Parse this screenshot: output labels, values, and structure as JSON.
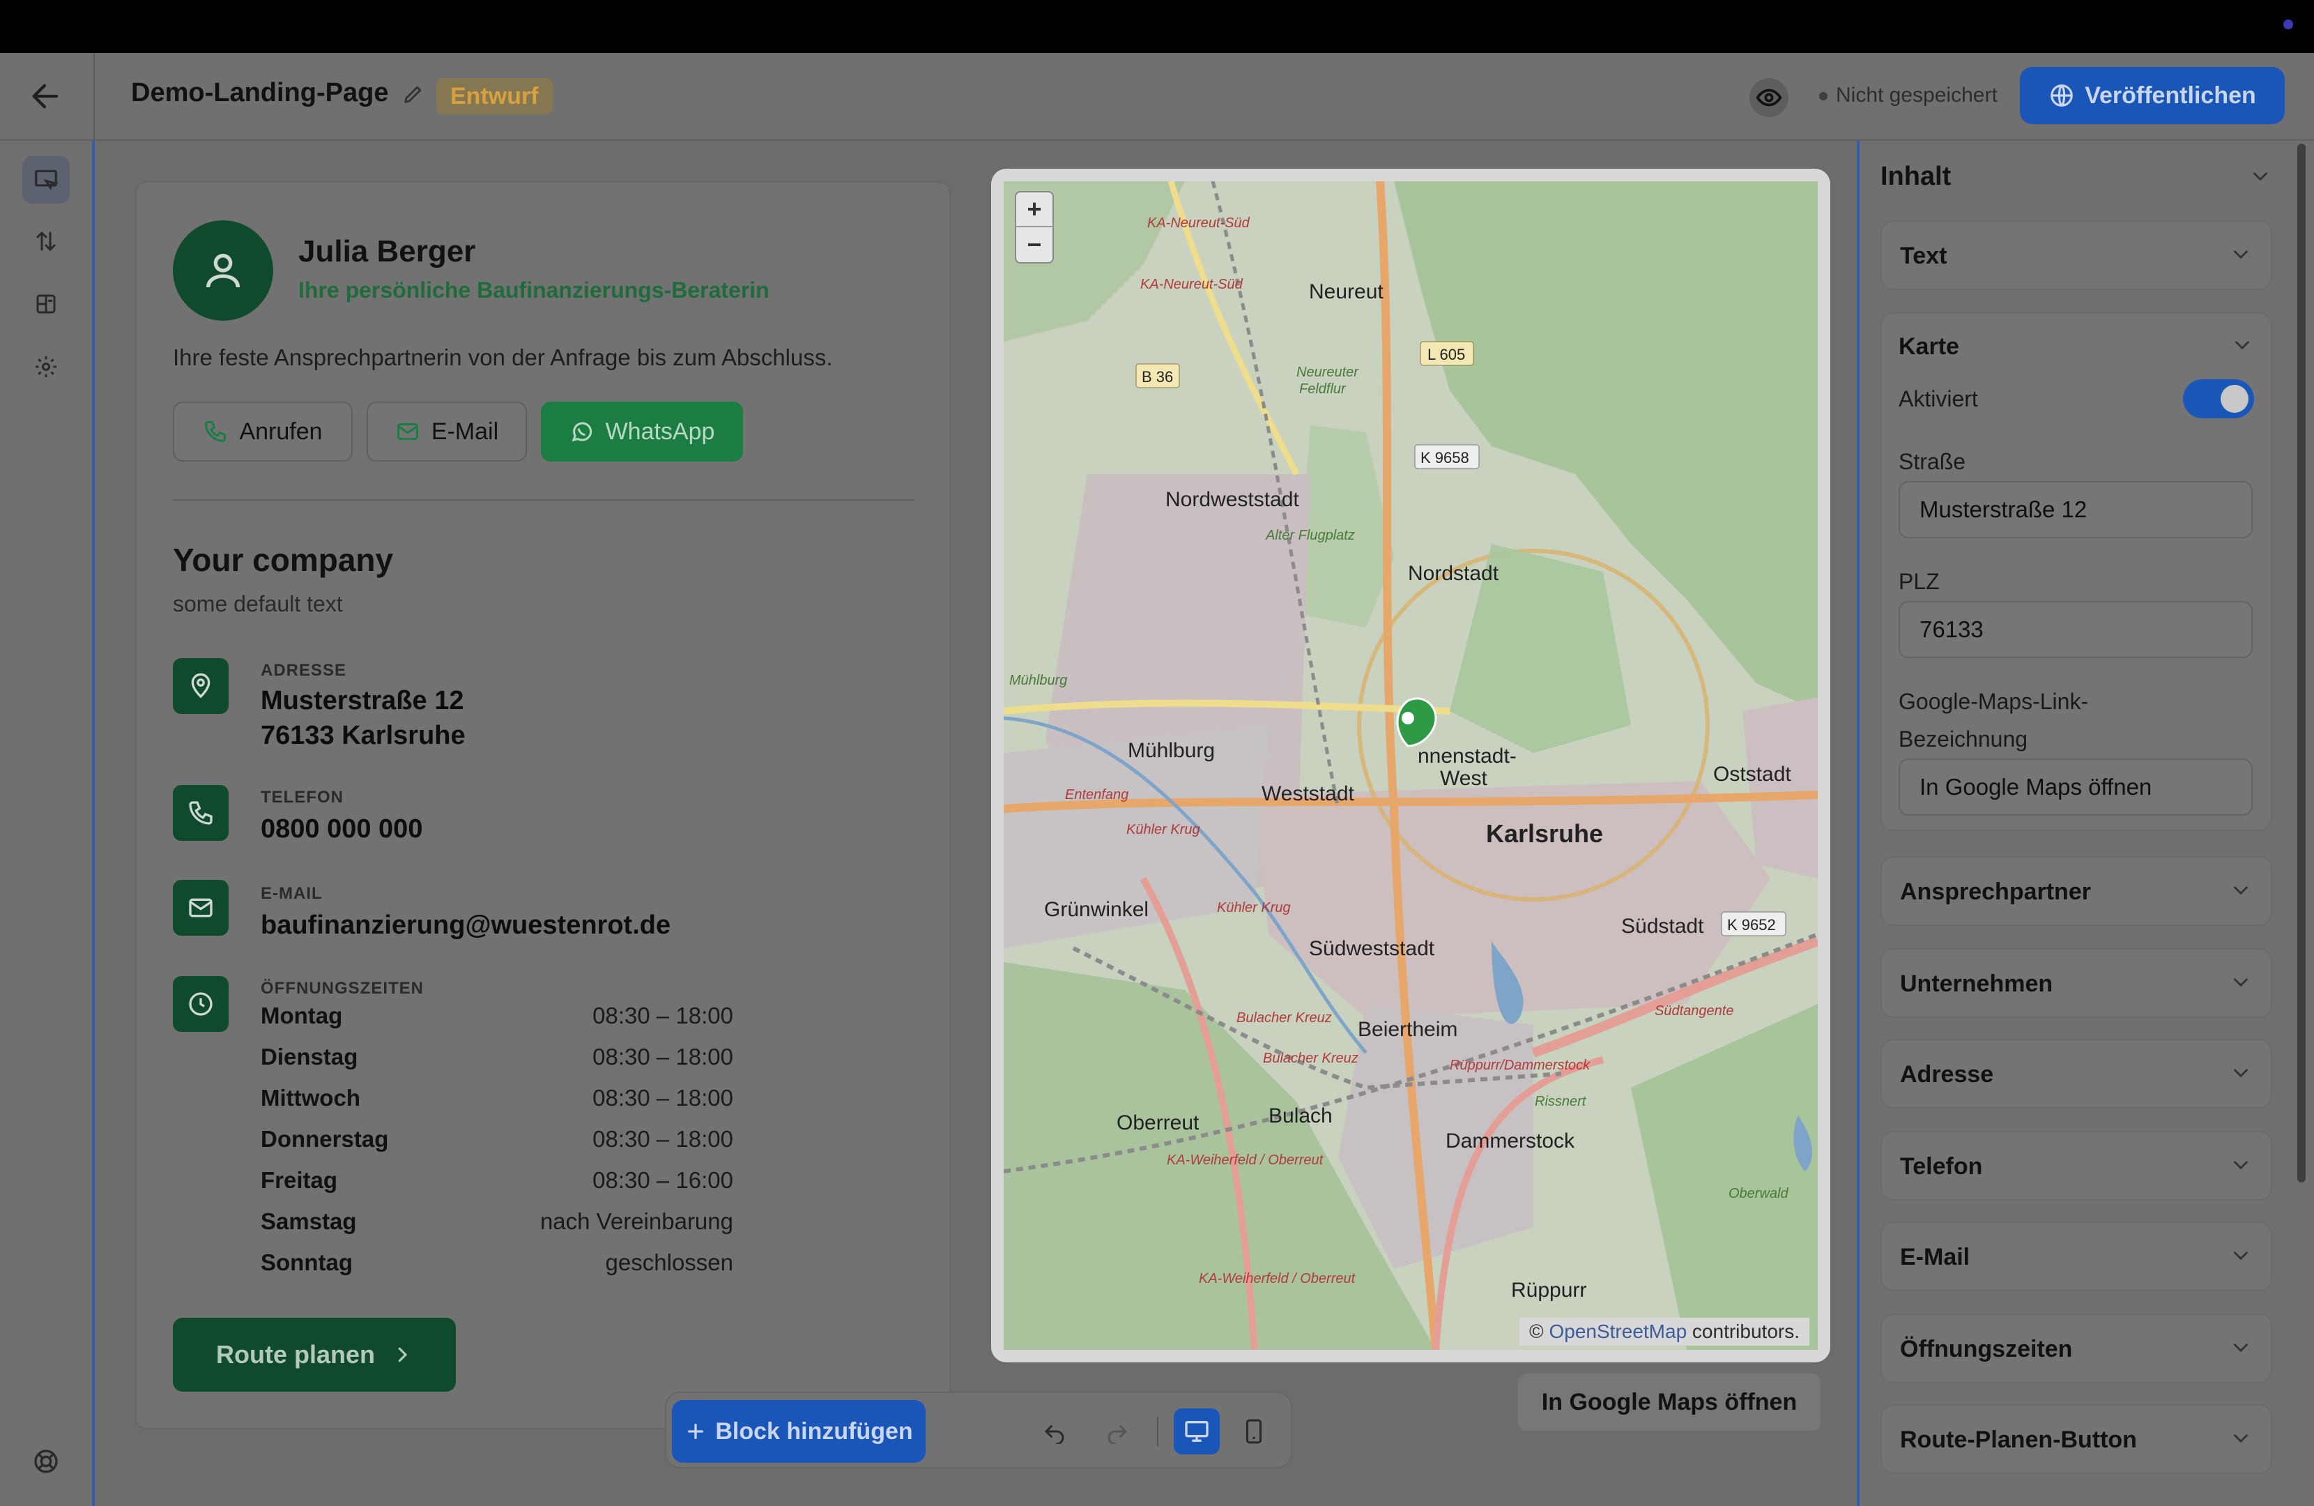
{
  "header": {
    "title": "Demo-Landing-Page",
    "status_badge": "Entwurf",
    "save_state": "Nicht gespeichert",
    "publish_label": "Veröffentlichen"
  },
  "contact_person": {
    "name": "Julia Berger",
    "role": "Ihre persönliche Baufinanzierungs-Beraterin",
    "description": "Ihre feste Ansprechpartnerin von der Anfrage bis zum Abschluss.",
    "buttons": {
      "call": "Anrufen",
      "email": "E-Mail",
      "whatsapp": "WhatsApp"
    }
  },
  "company": {
    "name": "Your company",
    "subtext": "some default text",
    "address_label": "ADRESSE",
    "address_line1": "Musterstraße 12",
    "address_line2": "76133 Karlsruhe",
    "phone_label": "TELEFON",
    "phone": "0800 000 000",
    "email_label": "E-MAIL",
    "email": "baufinanzierung@wuestenrot.de",
    "hours_label": "ÖFFNUNGSZEITEN",
    "hours": [
      {
        "day": "Montag",
        "time": "08:30 – 18:00"
      },
      {
        "day": "Dienstag",
        "time": "08:30 – 18:00"
      },
      {
        "day": "Mittwoch",
        "time": "08:30 – 18:00"
      },
      {
        "day": "Donnerstag",
        "time": "08:30 – 18:00"
      },
      {
        "day": "Freitag",
        "time": "08:30 – 16:00"
      },
      {
        "day": "Samstag",
        "time": "nach Vereinbarung"
      },
      {
        "day": "Sonntag",
        "time": "geschlossen"
      }
    ],
    "route_button": "Route planen"
  },
  "map": {
    "zoom_in": "+",
    "zoom_out": "−",
    "attribution_prefix": "©",
    "attribution_link": "OpenStreetMap",
    "attribution_suffix": "contributors.",
    "gmaps_button": "In Google Maps öffnen",
    "labels": {
      "neureut": "Neureut",
      "nordweststadt": "Nordweststadt",
      "nordstadt": "Nordstadt",
      "muehlburg": "Mühlburg",
      "innenstadt": "nnenstadt-",
      "west": "West",
      "weststadt": "Weststadt",
      "oststadt": "Oststadt",
      "karlsruhe": "Karlsruhe",
      "grunwinkel": "Grünwinkel",
      "suedweststadt": "Südweststadt",
      "suedstadt": "Südstadt",
      "beiertheim": "Beiertheim",
      "oberreut": "Oberreut",
      "bulach": "Bulach",
      "dammerstock": "Dammerstock",
      "rueppurr": "Rüppurr",
      "b36": "B 36",
      "l605": "L 605",
      "k9658": "K 9658",
      "k9652": "K 9652",
      "ka_neureut_sued_1": "KA-Neureut-Süd",
      "ka_neureut_sued_2": "KA-Neureut-Süd",
      "neureuter_feldflur_1": "Neureuter",
      "neureuter_feldflur_2": "Feldflur",
      "alter_flugplatz": "Alter Flugplatz",
      "entenfang": "Entenfang",
      "kuehler_krug_1": "Kühler Krug",
      "kuehler_krug_2": "Kühler Krug",
      "bulacher_kreuz_1": "Bulacher Kreuz",
      "bulacher_kreuz_2": "Bulacher Kreuz",
      "ka_weiherfeld_1": "KA-Weiherfeld / Oberreut",
      "ka_weiherfeld_2": "KA-Weiherfeld / Oberreut",
      "rueppurr_dammerstock": "Rüppurr/Dammerstock",
      "suedtangente": "Südtangente",
      "oberwald": "Oberwald",
      "rissnert": "Rissnert",
      "muehlburg_small": "Mühlburg"
    }
  },
  "floating_toolbar": {
    "add_block": "Block hinzufügen"
  },
  "panel": {
    "title": "Inhalt",
    "text_section": "Text",
    "karte": {
      "title": "Karte",
      "enabled_label": "Aktiviert",
      "enabled": true,
      "street_label": "Straße",
      "street_value": "Musterstraße 12",
      "zip_label": "PLZ",
      "zip_value": "76133",
      "link_label_line1": "Google-Maps-Link-",
      "link_label_line2": "Bezeichnung",
      "link_value": "In Google Maps öffnen"
    },
    "sections": [
      "Ansprechpartner",
      "Unternehmen",
      "Adresse",
      "Telefon",
      "E-Mail",
      "Öffnungszeiten",
      "Route-Planen-Button"
    ]
  }
}
